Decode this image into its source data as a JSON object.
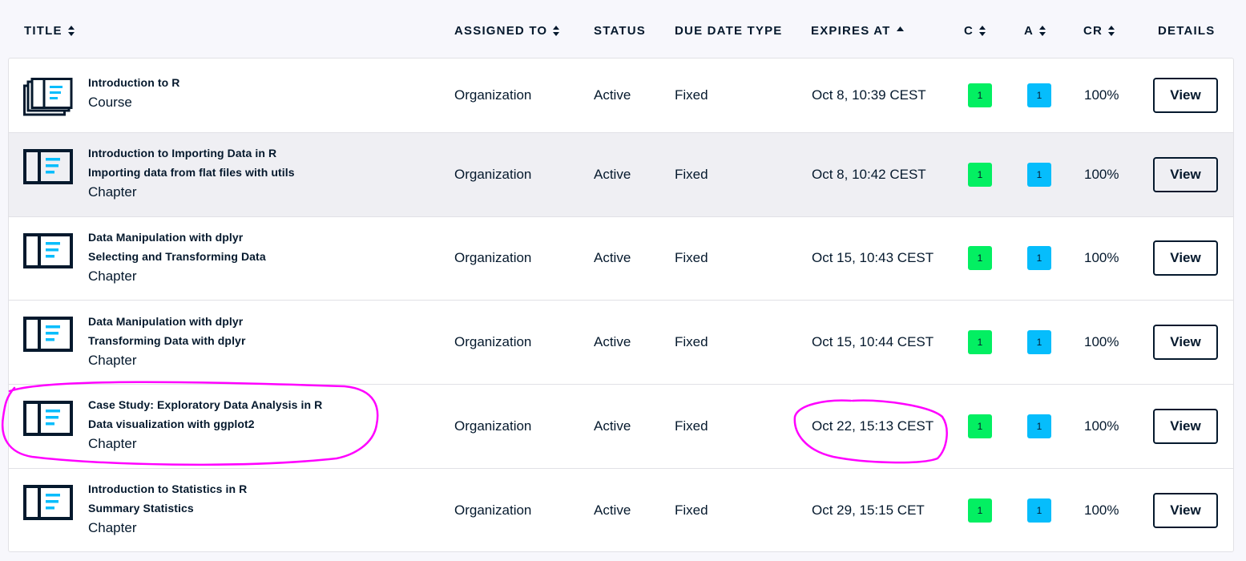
{
  "columns": {
    "title": "TITLE",
    "assigned_to": "ASSIGNED TO",
    "status": "STATUS",
    "due_date_type": "DUE DATE TYPE",
    "expires_at": "EXPIRES AT",
    "c": "C",
    "a": "A",
    "cr": "CR",
    "details": "DETAILS"
  },
  "rows": [
    {
      "icon": "course-icon",
      "title_lines": [
        "Introduction to R"
      ],
      "type": "Course",
      "assigned_to": "Organization",
      "status": "Active",
      "due_date_type": "Fixed",
      "expires_at": "Oct 8, 10:39 CEST",
      "c": "1",
      "a": "1",
      "cr": "100%",
      "action": "View"
    },
    {
      "icon": "chapter-icon",
      "title_lines": [
        "Introduction to Importing Data in R",
        "Importing data from flat files with utils"
      ],
      "type": "Chapter",
      "assigned_to": "Organization",
      "status": "Active",
      "due_date_type": "Fixed",
      "expires_at": "Oct 8, 10:42 CEST",
      "c": "1",
      "a": "1",
      "cr": "100%",
      "action": "View"
    },
    {
      "icon": "chapter-icon",
      "title_lines": [
        "Data Manipulation with dplyr",
        "Selecting and Transforming Data"
      ],
      "type": "Chapter",
      "assigned_to": "Organization",
      "status": "Active",
      "due_date_type": "Fixed",
      "expires_at": "Oct 15, 10:43 CEST",
      "c": "1",
      "a": "1",
      "cr": "100%",
      "action": "View"
    },
    {
      "icon": "chapter-icon",
      "title_lines": [
        "Data Manipulation with dplyr",
        "Transforming Data with dplyr"
      ],
      "type": "Chapter",
      "assigned_to": "Organization",
      "status": "Active",
      "due_date_type": "Fixed",
      "expires_at": "Oct 15, 10:44 CEST",
      "c": "1",
      "a": "1",
      "cr": "100%",
      "action": "View"
    },
    {
      "icon": "chapter-icon",
      "title_lines": [
        "Case Study: Exploratory Data Analysis in R",
        "Data visualization with ggplot2"
      ],
      "type": "Chapter",
      "assigned_to": "Organization",
      "status": "Active",
      "due_date_type": "Fixed",
      "expires_at": "Oct 22, 15:13 CEST",
      "c": "1",
      "a": "1",
      "cr": "100%",
      "action": "View"
    },
    {
      "icon": "chapter-icon",
      "title_lines": [
        "Introduction to Statistics in R",
        "Summary Statistics"
      ],
      "type": "Chapter",
      "assigned_to": "Organization",
      "status": "Active",
      "due_date_type": "Fixed",
      "expires_at": "Oct 29, 15:15 CET",
      "c": "1",
      "a": "1",
      "cr": "100%",
      "action": "View"
    }
  ],
  "colors": {
    "ink": "#05192d",
    "completed_badge": "#03ef62",
    "assigned_badge": "#06bdfc",
    "annotation": "#ff00ff",
    "hover_row": "#efeff3"
  }
}
